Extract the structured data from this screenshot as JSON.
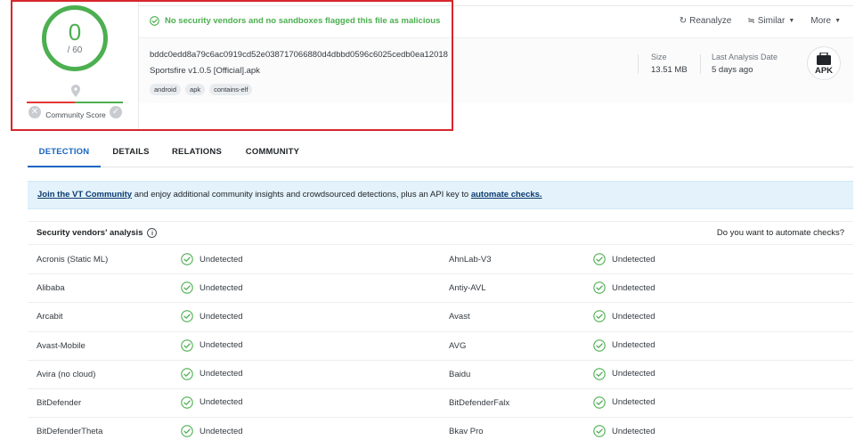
{
  "summary": {
    "score": "0",
    "score_total": "/ 60",
    "community_score_label": "Community Score",
    "verdict": "No security vendors and no sandboxes flagged this file as malicious",
    "actions": {
      "reanalyze": "Reanalyze",
      "similar": "Similar",
      "more": "More"
    },
    "hash": "bddc0edd8a79c6ac0919cd52e038717066880d4dbbd0596c6025cedb0ea12018",
    "file_name": "Sportsfire v1.0.5 [Official].apk",
    "tags": [
      "android",
      "apk",
      "contains-elf"
    ],
    "size_label": "Size",
    "size_value": "13.51 MB",
    "last_analysis_label": "Last Analysis Date",
    "last_analysis_value": "5 days ago",
    "file_type_badge": "APK"
  },
  "tabs": [
    "DETECTION",
    "DETAILS",
    "RELATIONS",
    "COMMUNITY"
  ],
  "banner": {
    "link1": "Join the VT Community",
    "middle": " and enjoy additional community insights and crowdsourced detections, plus an API key to ",
    "link2": "automate checks."
  },
  "vendors_table": {
    "title": "Security vendors' analysis",
    "right_text": "Do you want to automate checks?",
    "rows": [
      {
        "left_vendor": "Acronis (Static ML)",
        "left_result": "Undetected",
        "right_vendor": "AhnLab-V3",
        "right_result": "Undetected"
      },
      {
        "left_vendor": "Alibaba",
        "left_result": "Undetected",
        "right_vendor": "Antiy-AVL",
        "right_result": "Undetected"
      },
      {
        "left_vendor": "Arcabit",
        "left_result": "Undetected",
        "right_vendor": "Avast",
        "right_result": "Undetected"
      },
      {
        "left_vendor": "Avast-Mobile",
        "left_result": "Undetected",
        "right_vendor": "AVG",
        "right_result": "Undetected"
      },
      {
        "left_vendor": "Avira (no cloud)",
        "left_result": "Undetected",
        "right_vendor": "Baidu",
        "right_result": "Undetected"
      },
      {
        "left_vendor": "BitDefender",
        "left_result": "Undetected",
        "right_vendor": "BitDefenderFalx",
        "right_result": "Undetected"
      },
      {
        "left_vendor": "BitDefenderTheta",
        "left_result": "Undetected",
        "right_vendor": "Bkav Pro",
        "right_result": "Undetected"
      }
    ]
  },
  "colors": {
    "clean_green": "#4caf50",
    "active_tab_blue": "#1565c0",
    "highlight_red": "#d7262b",
    "banner_bg": "#e3f2fb"
  },
  "icons": {
    "verdict": "check-circle-icon",
    "reanalyze": "refresh-icon",
    "similar": "similar-icon",
    "result": "check-circle-icon",
    "file_type": "apk-file-icon",
    "community": "location-pin-icon"
  }
}
